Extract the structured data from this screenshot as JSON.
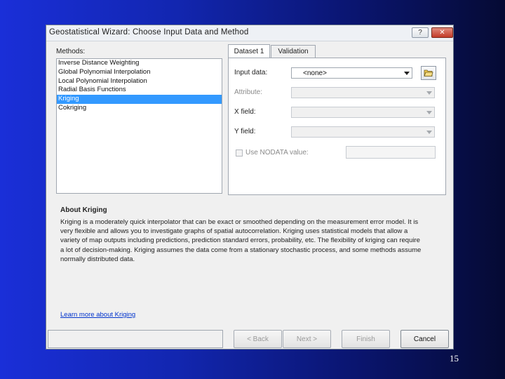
{
  "window": {
    "title": "Geostatistical Wizard: Choose Input Data and Method",
    "help_label": "?",
    "close_label": "✕"
  },
  "methods": {
    "label": "Methods:",
    "items": [
      "Inverse Distance Weighting",
      "Global Polynomial Interpolation",
      "Local Polynomial Interpolation",
      "Radial Basis Functions",
      "Kriging",
      "Cokriging"
    ],
    "selected": "Kriging"
  },
  "tabs": [
    "Dataset 1",
    "Validation"
  ],
  "dataset": {
    "input_label": "Input data:",
    "input_value": "<none>",
    "attribute_label": "Attribute:",
    "x_label": "X field:",
    "y_label": "Y field:",
    "nodata_label": "Use NODATA value:"
  },
  "about": {
    "title": "About Kriging",
    "text": "Kriging is a moderately quick interpolator that can be exact or smoothed depending on the measurement error model. It is very flexible and allows you to investigate graphs of spatial autocorrelation. Kriging uses statistical models that allow a variety of map outputs including predictions, prediction standard errors, probability, etc. The flexibility of kriging can require a lot of decision-making. Kriging assumes the data come from a stationary stochastic process, and some methods assume normally distributed data.",
    "link": "Learn more about Kriging"
  },
  "buttons": {
    "back": "< Back",
    "next": "Next >",
    "finish": "Finish",
    "cancel": "Cancel"
  },
  "slide_number": "15",
  "colors": {
    "selection": "#3399ff",
    "link": "#0033cc",
    "background_start": "#1a2fd8",
    "background_end": "#050a33"
  }
}
